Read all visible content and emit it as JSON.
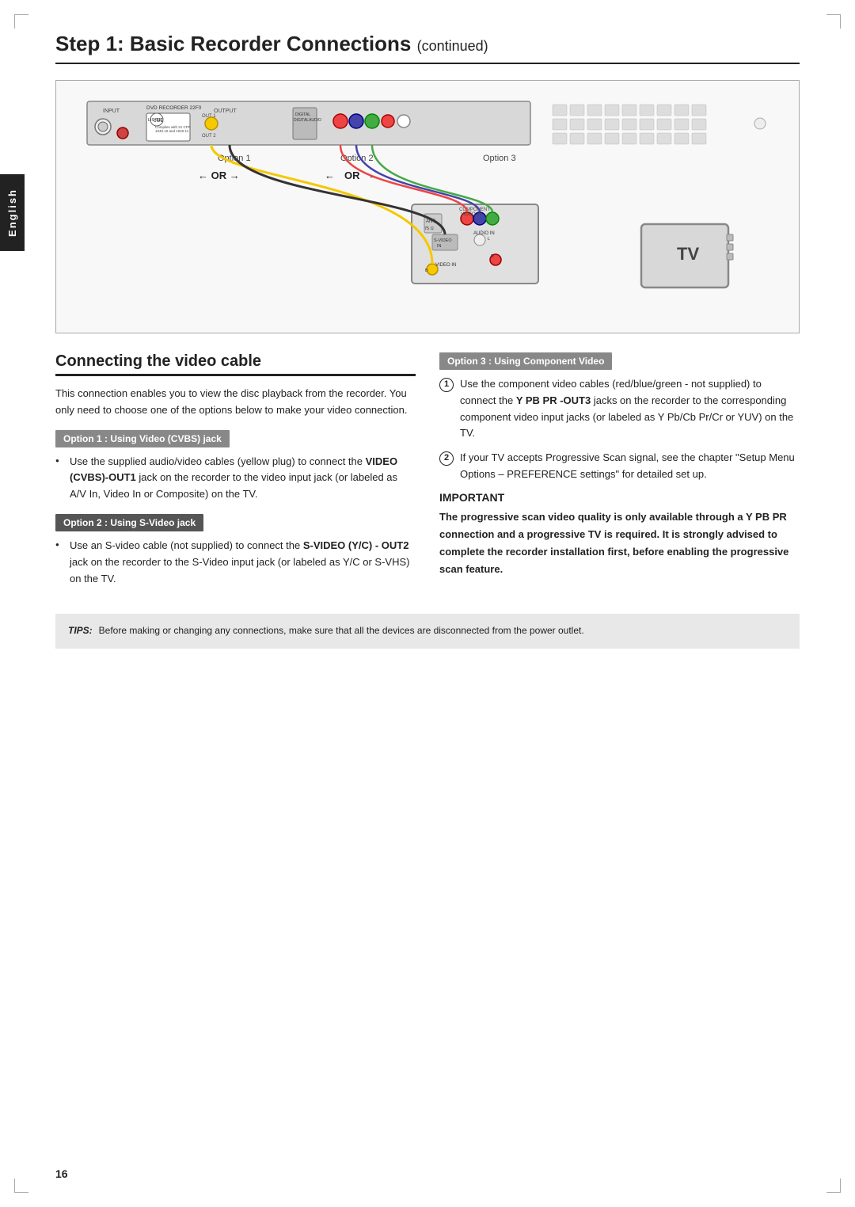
{
  "page": {
    "title": "Step 1: Basic Recorder Connections",
    "title_suffix": "continued",
    "page_number": "16",
    "language_tab": "English"
  },
  "diagram": {
    "option1_label": "Option 1",
    "option2_label": "Option 2",
    "option3_label": "Option 3",
    "or_text": "OR",
    "or_text2": "OR",
    "arrow_left": "← OR →",
    "tv_label": "TV"
  },
  "section": {
    "title": "Connecting the video cable",
    "intro": "This connection enables you to view the disc playback from the recorder. You only need to choose one of the options below to make your video connection."
  },
  "option1": {
    "box_label": "Option 1 : Using Video (CVBS) jack",
    "content": "Use the supplied audio/video cables (yellow plug) to connect the VIDEO (CVBS)-OUT1 jack on the recorder to the video input jack (or labeled as A/V In, Video In or Composite) on the TV."
  },
  "option2": {
    "box_label": "Option 2 : Using S-Video jack",
    "content_prefix": "Use an S-video cable (not supplied) to connect the ",
    "content_bold": "S-VIDEO (Y/C) - OUT2",
    "content_suffix": " jack on the recorder to the S-Video input jack (or labeled as Y/C or S-VHS) on the TV."
  },
  "option3": {
    "box_label": "Option 3 : Using Component Video",
    "item1_prefix": "Use the component video cables (red/blue/green - not supplied) to connect the ",
    "item1_bold": "Y PB PR -OUT3",
    "item1_suffix": " jacks on the recorder to the corresponding component video input jacks (or labeled as Y Pb/Cb Pr/Cr or YUV) on the TV.",
    "item2": "If your TV accepts Progressive Scan signal, see the chapter \"Setup Menu Options – PREFERENCE settings\" for detailed set up."
  },
  "important": {
    "title": "IMPORTANT",
    "text_bold": "The progressive scan video quality is only available through a Y PB PR connection and a progressive TV is required. It is strongly advised to complete the recorder installation first, before enabling the progressive scan feature."
  },
  "tips": {
    "label": "TIPS:",
    "text": "Before making or changing any connections, make sure that all the devices are disconnected from the power outlet."
  }
}
